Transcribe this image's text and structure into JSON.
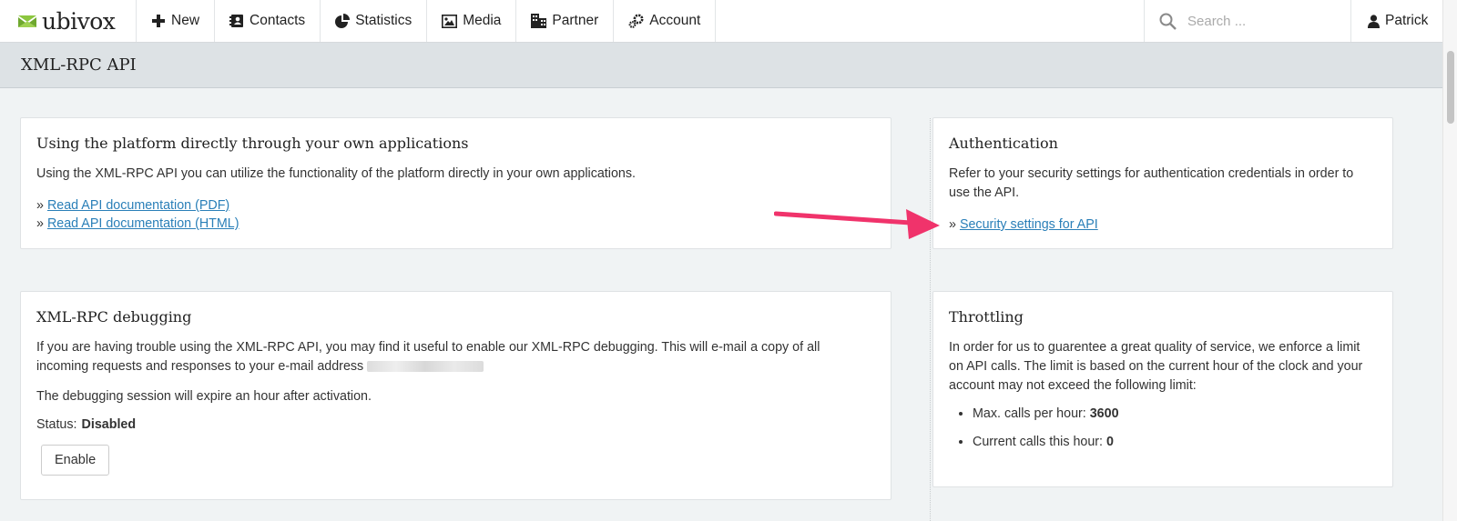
{
  "app": {
    "logo_text": "ubivox"
  },
  "nav": [
    {
      "label": "New",
      "icon": "plus-icon"
    },
    {
      "label": "Contacts",
      "icon": "contacts-book-icon"
    },
    {
      "label": "Statistics",
      "icon": "pie-chart-icon"
    },
    {
      "label": "Media",
      "icon": "image-icon"
    },
    {
      "label": "Partner",
      "icon": "building-icon"
    },
    {
      "label": "Account",
      "icon": "gears-icon"
    }
  ],
  "search": {
    "placeholder": "Search ..."
  },
  "user": {
    "name": "Patrick",
    "icon": "user-icon"
  },
  "page": {
    "title": "XML-RPC API"
  },
  "platform_card": {
    "title": "Using the platform directly through your own applications",
    "description": "Using the XML-RPC API you can utilize the functionality of the platform directly in your own applications.",
    "links": [
      "Read API documentation (PDF)",
      "Read API documentation (HTML)"
    ],
    "prefix": "»"
  },
  "debug_card": {
    "title": "XML-RPC debugging",
    "description": "If you are having trouble using the XML-RPC API, you may find it useful to enable our XML-RPC debugging. This will e-mail a copy of all incoming requests and responses to your e-mail address",
    "expiry_note": "The debugging session will expire an hour after activation.",
    "status_label": "Status:",
    "status_value": "Disabled",
    "enable_button": "Enable"
  },
  "auth_card": {
    "title": "Authentication",
    "description": "Refer to your security settings for authentication credentials in order to use the API.",
    "prefix": "»",
    "link": "Security settings for API"
  },
  "throttle_card": {
    "title": "Throttling",
    "description": "In order for us to guarentee a great quality of service, we enforce a limit on API calls. The limit is based on the current hour of the clock and your account may not exceed the following limit:",
    "items": [
      {
        "label": "Max. calls per hour:",
        "value": "3600"
      },
      {
        "label": "Current calls this hour:",
        "value": "0"
      }
    ]
  },
  "colors": {
    "accent_link": "#2a7fb8",
    "annotation_arrow": "#f0336b",
    "logo_green": "#8cc63f"
  }
}
